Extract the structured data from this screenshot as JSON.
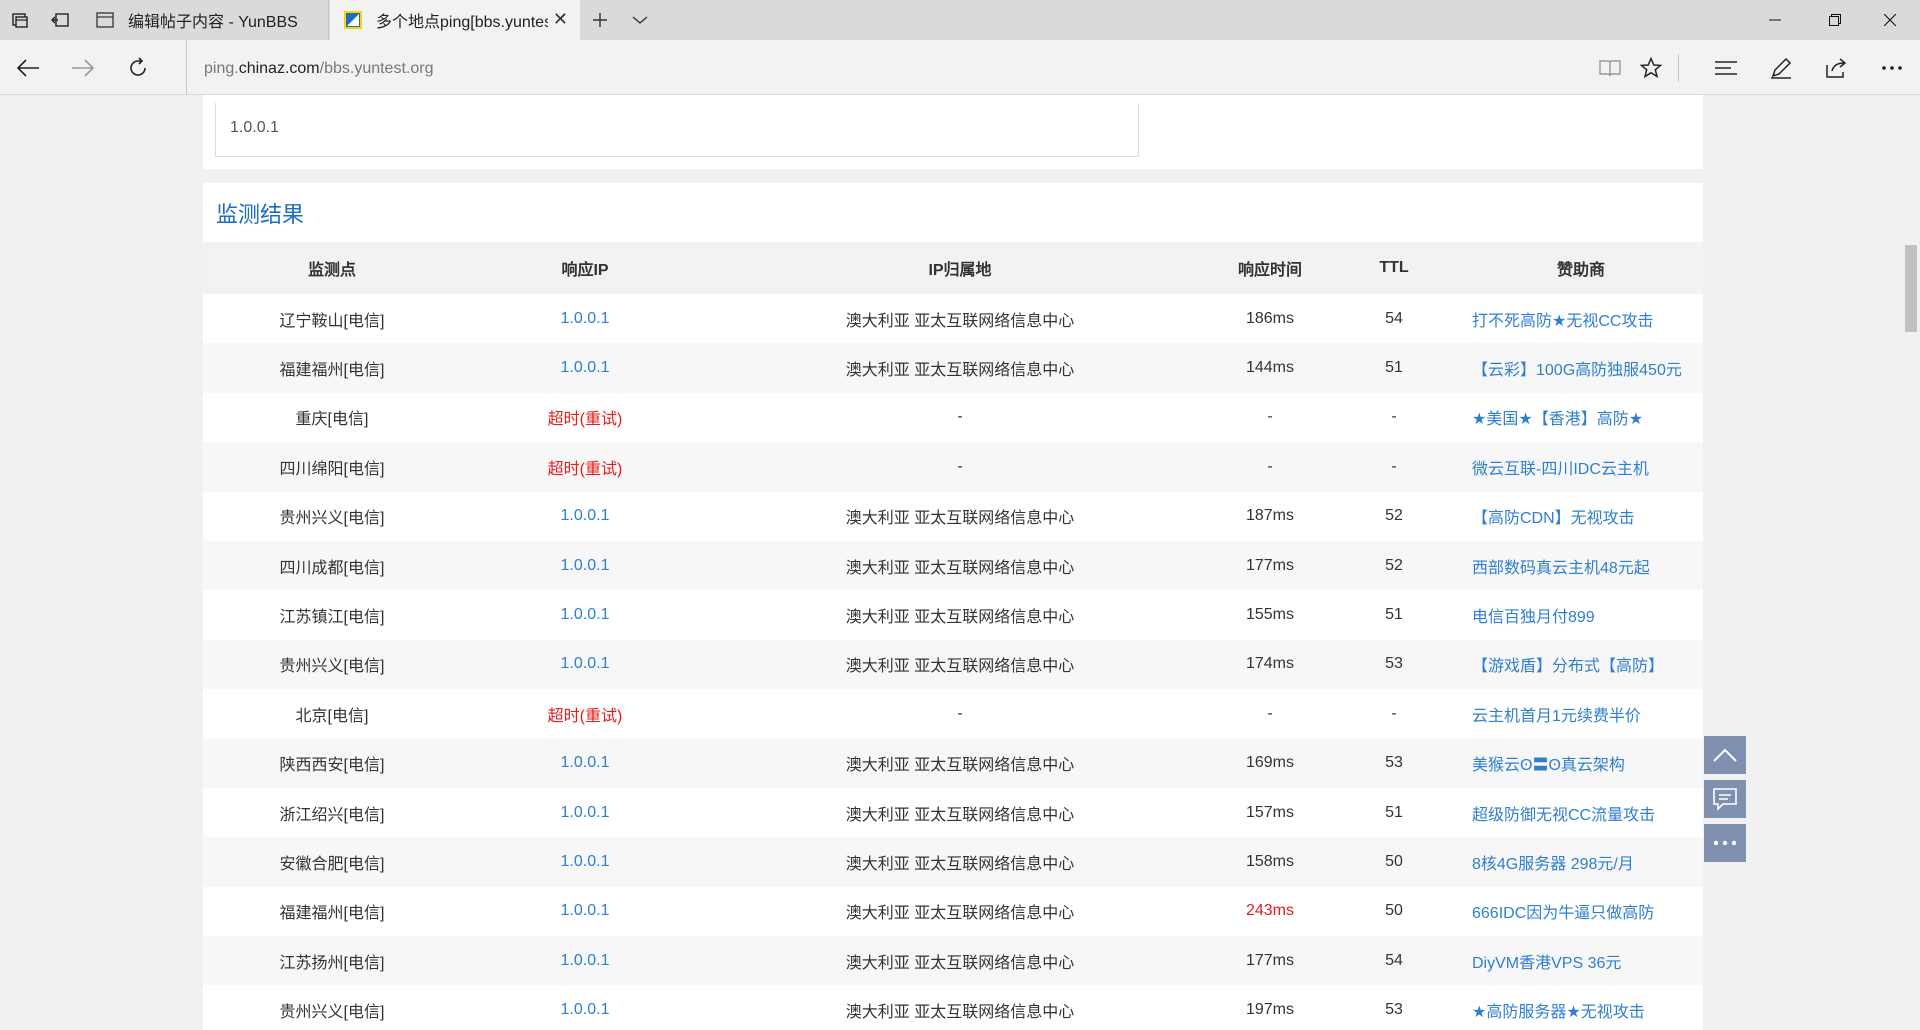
{
  "tabs": [
    {
      "title": "编辑帖子内容 - YunBBS",
      "active": false
    },
    {
      "title": "多个地点ping[bbs.yuntest.org]",
      "active": true
    }
  ],
  "address": {
    "url_prefix": "ping.",
    "url_domain": "chinaz.com",
    "url_path": "/bbs.yuntest.org"
  },
  "top_input": {
    "value": "1.0.0.1"
  },
  "results": {
    "title": "监测结果",
    "columns": [
      "监测点",
      "响应IP",
      "IP归属地",
      "响应时间",
      "TTL",
      "赞助商"
    ],
    "timeout_label": "超时",
    "retry_label": "(重试)",
    "rows": [
      {
        "node": "辽宁鞍山[电信]",
        "ip": "1.0.0.1",
        "location": "澳大利亚 亚太互联网络信息中心",
        "time": "186ms",
        "ttl": "54",
        "sponsor": "打不死高防★无视CC攻击"
      },
      {
        "node": "福建福州[电信]",
        "ip": "1.0.0.1",
        "location": "澳大利亚 亚太互联网络信息中心",
        "time": "144ms",
        "ttl": "51",
        "sponsor": "【云彩】100G高防独服450元"
      },
      {
        "node": "重庆[电信]",
        "ip": "",
        "timeout": true,
        "location": "-",
        "time": "-",
        "ttl": "-",
        "sponsor": "★美国★【香港】高防★"
      },
      {
        "node": "四川绵阳[电信]",
        "ip": "",
        "timeout": true,
        "location": "-",
        "time": "-",
        "ttl": "-",
        "sponsor": "微云互联-四川IDC云主机"
      },
      {
        "node": "贵州兴义[电信]",
        "ip": "1.0.0.1",
        "location": "澳大利亚 亚太互联网络信息中心",
        "time": "187ms",
        "ttl": "52",
        "sponsor": "【高防CDN】无视攻击"
      },
      {
        "node": "四川成都[电信]",
        "ip": "1.0.0.1",
        "location": "澳大利亚 亚太互联网络信息中心",
        "time": "177ms",
        "ttl": "52",
        "sponsor": "西部数码真云主机48元起"
      },
      {
        "node": "江苏镇江[电信]",
        "ip": "1.0.0.1",
        "location": "澳大利亚 亚太互联网络信息中心",
        "time": "155ms",
        "ttl": "51",
        "sponsor": "电信百独月付899"
      },
      {
        "node": "贵州兴义[电信]",
        "ip": "1.0.0.1",
        "location": "澳大利亚 亚太互联网络信息中心",
        "time": "174ms",
        "ttl": "53",
        "sponsor": "【游戏盾】分布式【高防】"
      },
      {
        "node": "北京[电信]",
        "ip": "",
        "timeout": true,
        "location": "-",
        "time": "-",
        "ttl": "-",
        "sponsor": "云主机首月1元续费半价"
      },
      {
        "node": "陕西西安[电信]",
        "ip": "1.0.0.1",
        "location": "澳大利亚 亚太互联网络信息中心",
        "time": "169ms",
        "ttl": "53",
        "sponsor": "美猴云ʘ〓ʘ真云架构"
      },
      {
        "node": "浙江绍兴[电信]",
        "ip": "1.0.0.1",
        "location": "澳大利亚 亚太互联网络信息中心",
        "time": "157ms",
        "ttl": "51",
        "sponsor": "超级防御无视CC流量攻击"
      },
      {
        "node": "安徽合肥[电信]",
        "ip": "1.0.0.1",
        "location": "澳大利亚 亚太互联网络信息中心",
        "time": "158ms",
        "ttl": "50",
        "sponsor": "8核4G服务器 298元/月"
      },
      {
        "node": "福建福州[电信]",
        "ip": "1.0.0.1",
        "location": "澳大利亚 亚太互联网络信息中心",
        "time": "243ms",
        "ttl": "50",
        "sponsor": "666IDC因为牛逼只做高防",
        "slow": true
      },
      {
        "node": "江苏扬州[电信]",
        "ip": "1.0.0.1",
        "location": "澳大利亚 亚太互联网络信息中心",
        "time": "177ms",
        "ttl": "54",
        "sponsor": "DiyVM香港VPS 36元"
      },
      {
        "node": "贵州兴义[电信]",
        "ip": "1.0.0.1",
        "location": "澳大利亚 亚太互联网络信息中心",
        "time": "197ms",
        "ttl": "53",
        "sponsor": "★高防服务器★无视攻击"
      }
    ]
  },
  "colors": {
    "link": "#2f7fd0",
    "timeout": "#e41e1e",
    "title": "#1a6fc4",
    "float_button": "#8090b0"
  }
}
